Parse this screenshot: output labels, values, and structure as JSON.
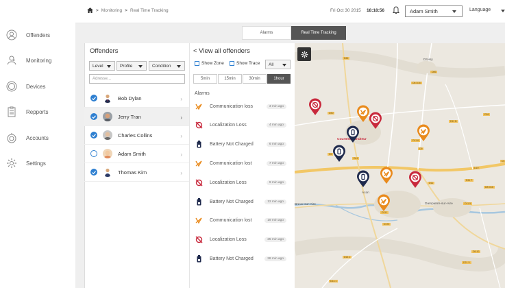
{
  "nav": {
    "items": [
      {
        "label": "Offenders"
      },
      {
        "label": "Monitoring"
      },
      {
        "label": "Devices"
      },
      {
        "label": "Repports"
      },
      {
        "label": "Accounts"
      },
      {
        "label": "Settings"
      }
    ]
  },
  "topbar": {
    "breadcrumb": [
      "Monitoring",
      "Real Time Tracking"
    ],
    "date": "Fri Oct 30 2015",
    "time": "18:18:56",
    "user": "Adam Smith",
    "language": "Language"
  },
  "view_tabs": {
    "alarms": "Alarms",
    "realtime": "Real Time Tracking"
  },
  "offenders_panel": {
    "title": "Offenders",
    "filters": [
      "Level",
      "Profile",
      "Condition"
    ],
    "address_placeholder": "Adresse...",
    "offenders": [
      {
        "name": "Bob Dylan",
        "checked": true
      },
      {
        "name": "Jerry Tran",
        "checked": true
      },
      {
        "name": "Charles Collins",
        "checked": true
      },
      {
        "name": "Adam Smith",
        "checked": false
      },
      {
        "name": "Thomas Kim",
        "checked": true
      }
    ]
  },
  "alarms_panel": {
    "back_label": "< View all offenders",
    "show_zone": "Show Zone",
    "show_trace": "Show Trace",
    "all_select": "All",
    "ranges": [
      "5min",
      "15min",
      "30min",
      "1hour"
    ],
    "heading": "Alarms",
    "alarms": [
      {
        "type": "communication",
        "text": "Communication loss",
        "time": "3 min ago"
      },
      {
        "type": "localization",
        "text": "Localization Loss",
        "time": "4 min ago"
      },
      {
        "type": "battery",
        "text": "Battery Not Charged",
        "time": "6 min ago"
      },
      {
        "type": "communication",
        "text": "Communication lost",
        "time": "7 min ago"
      },
      {
        "type": "localization",
        "text": "Localization Loss",
        "time": "9 min ago"
      },
      {
        "type": "battery",
        "text": "Battery Not Charged",
        "time": "12 min ago"
      },
      {
        "type": "communication",
        "text": "Communication lost",
        "time": "19 min ago"
      },
      {
        "type": "localization",
        "text": "Localization Loss",
        "time": "25 min ago"
      },
      {
        "type": "battery",
        "text": "Battery Not Charged",
        "time": "28 min ago"
      }
    ]
  },
  "map": {
    "places": [
      "Droisy",
      "Courtenne Traiteur",
      "Acon",
      "Breux-sur-Aire",
      "Dampierre-sur-Aire"
    ],
    "road_labels": [
      "D44",
      "D86",
      "D8 D16",
      "D26",
      "D311.10",
      "D11 B",
      "D30",
      "D11.6",
      "D41",
      "D5",
      "D9",
      "D11",
      "D11 7",
      "D8 D16",
      "D11 5",
      "D172",
      "D111",
      "D14 1",
      "D5.10",
      "D21 V",
      "D19",
      "D1",
      "D14.1"
    ]
  },
  "colors": {
    "accent": "#2f80d1",
    "pin_red": "#c8283c",
    "pin_orange": "#e98a1c",
    "pin_navy": "#1f2a4d",
    "map_bg": "#ece8e0"
  }
}
